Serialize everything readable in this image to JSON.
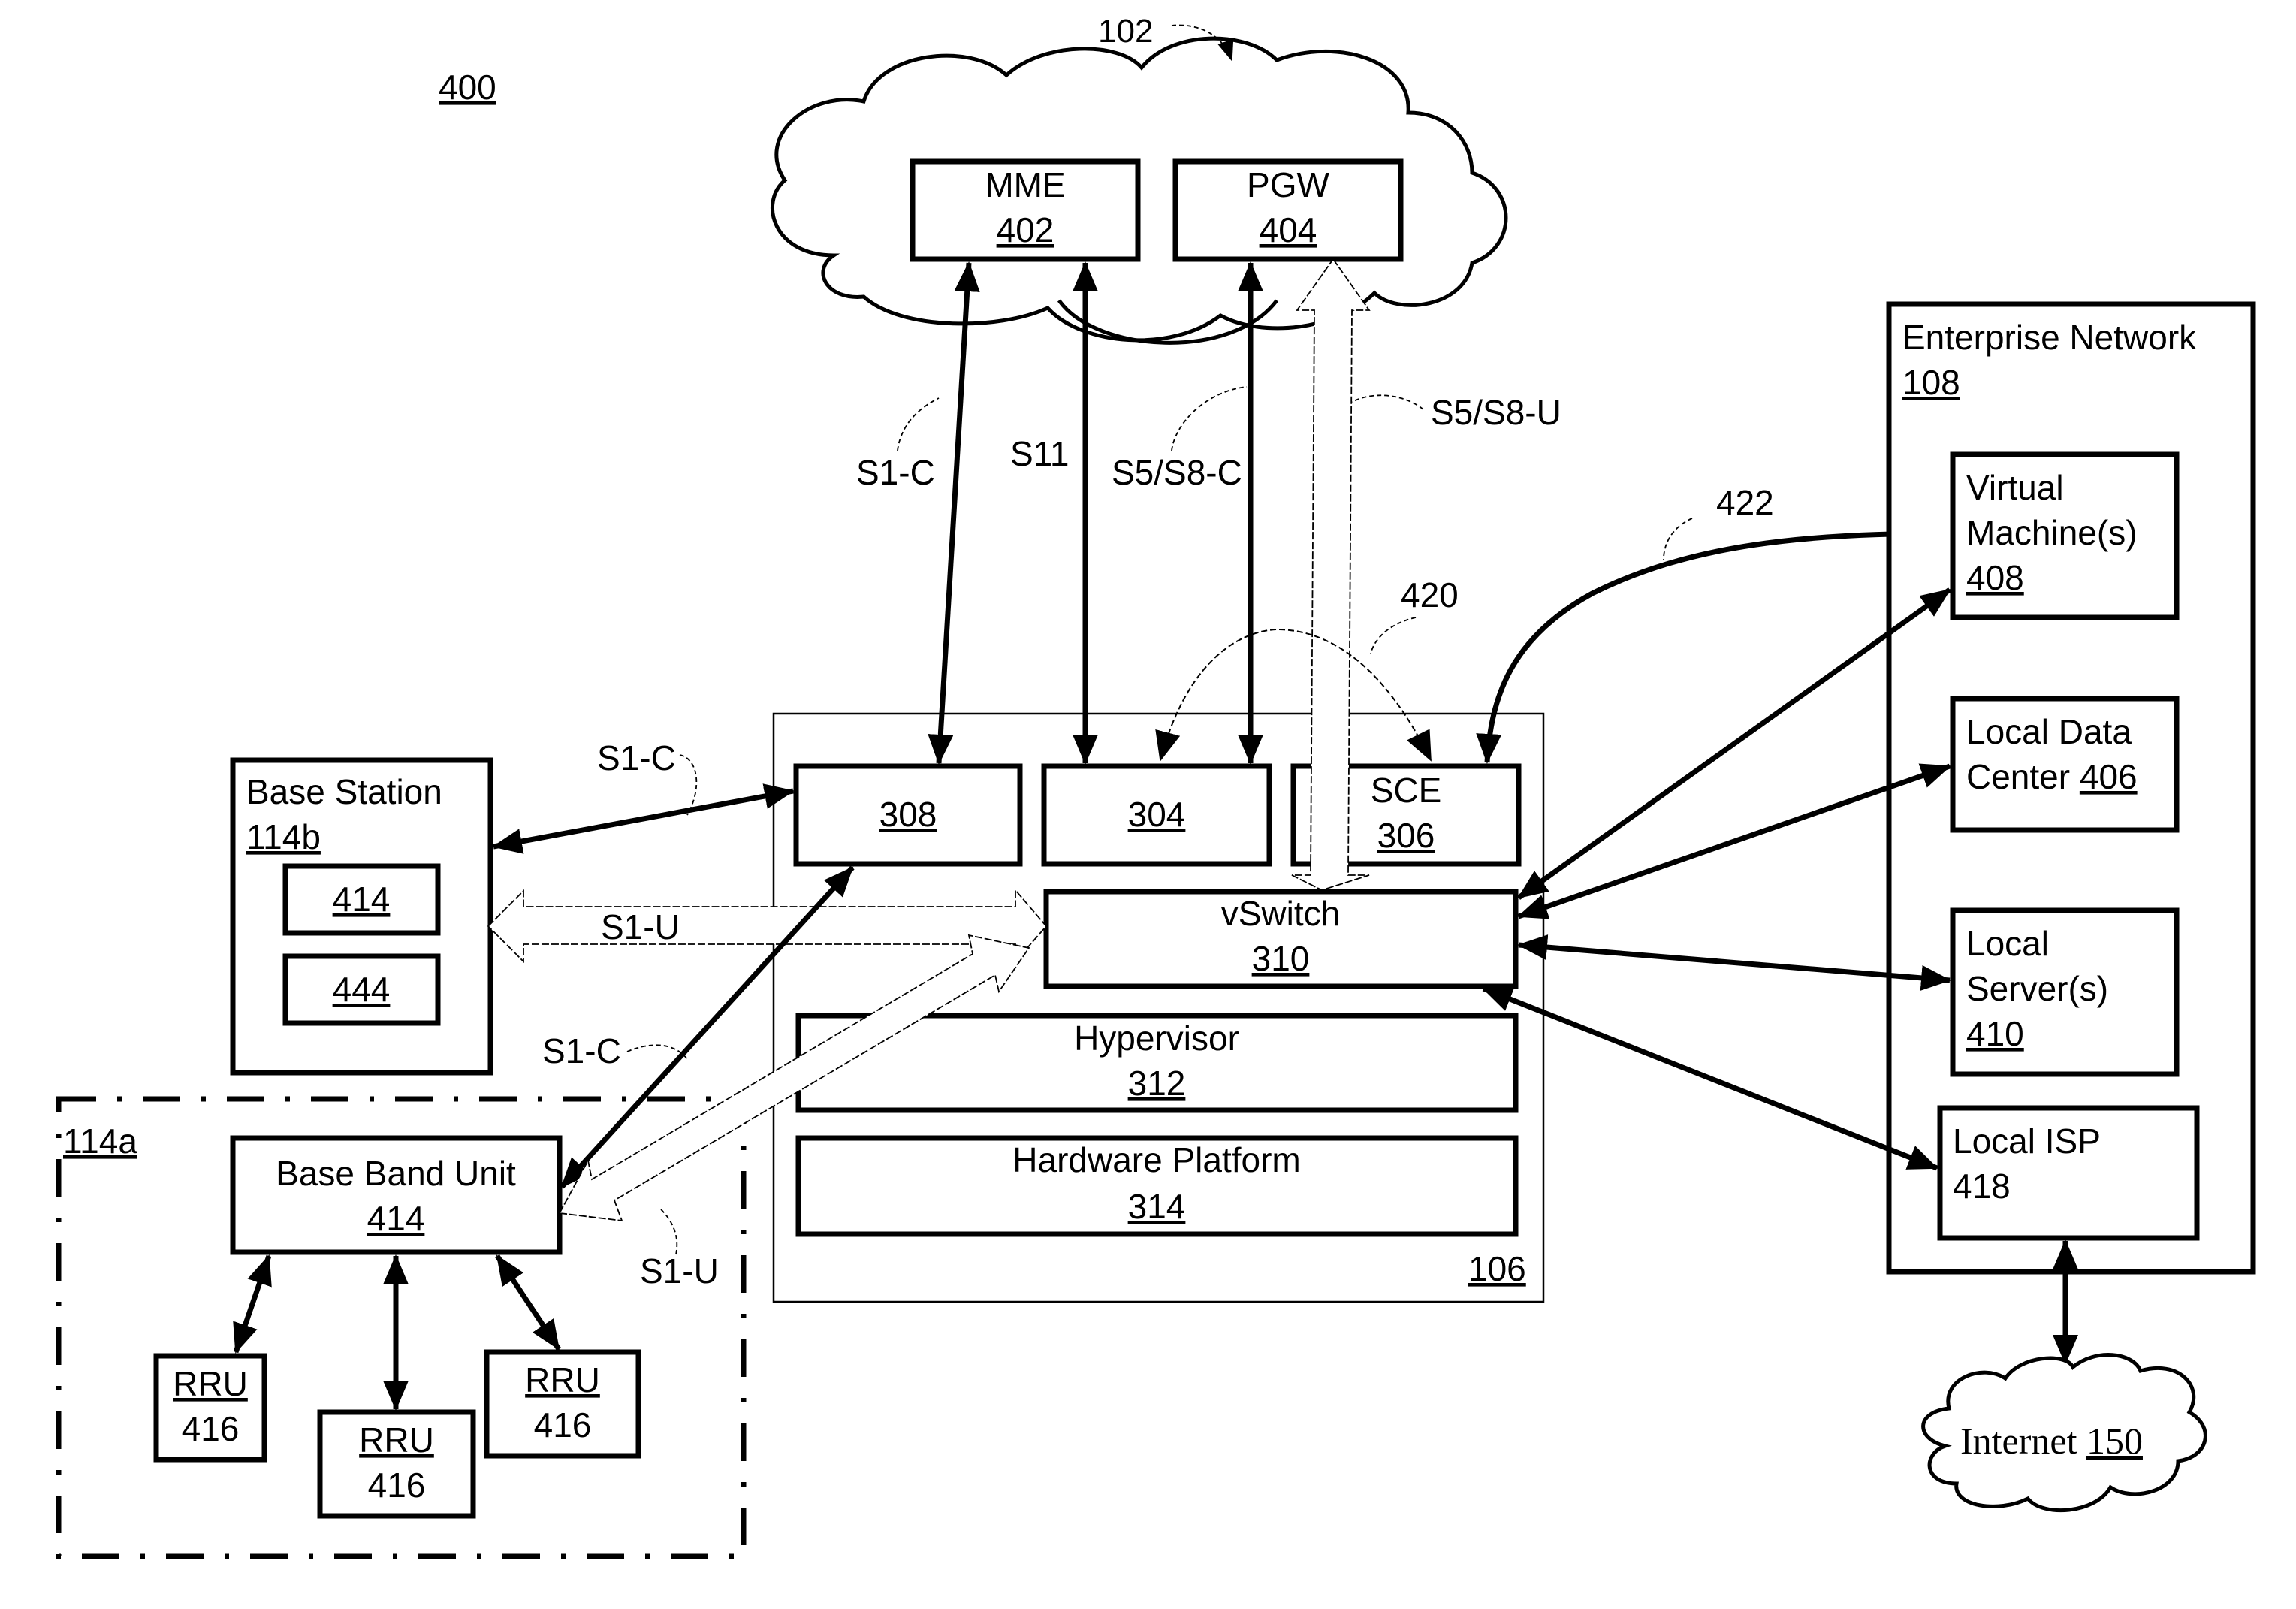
{
  "figure": {
    "ref": "400"
  },
  "core_network": {
    "ref": "102",
    "mme": {
      "label": "MME",
      "ref": "402"
    },
    "pgw": {
      "label": "PGW",
      "ref": "404"
    }
  },
  "interfaces": {
    "s1c_top": "S1-C",
    "s11": "S11",
    "s5s8c": "S5/S8-C",
    "s5s8u": "S5/S8-U",
    "s1c_bs": "S1-C",
    "s1u_bs": "S1-U",
    "s1c_bbu": "S1-C",
    "s1u_bbu": "S1-U"
  },
  "flows": {
    "flow_420": "420",
    "flow_422": "422"
  },
  "edge_node": {
    "ref": "106",
    "box_308": {
      "ref": "308"
    },
    "box_304": {
      "ref": "304"
    },
    "sce": {
      "label": "SCE",
      "ref": "306"
    },
    "vswitch": {
      "label": "vSwitch",
      "ref": "310"
    },
    "hypervisor": {
      "label": "Hypervisor",
      "ref": "312"
    },
    "hardware": {
      "label": "Hardware Platform",
      "ref": "314"
    }
  },
  "base_station": {
    "label": "Base Station",
    "ref": "114b",
    "inner": [
      {
        "ref": "414"
      },
      {
        "ref": "444"
      }
    ]
  },
  "distributed_bs": {
    "ref": "114a",
    "bbu": {
      "label": "Base Band Unit",
      "ref": "414"
    },
    "rrus": [
      {
        "label": "RRU",
        "ref": "416"
      },
      {
        "label": "RRU",
        "ref": "416"
      },
      {
        "label": "RRU",
        "ref": "416"
      }
    ]
  },
  "enterprise": {
    "label": "Enterprise Network",
    "ref": "108",
    "vm": {
      "line1": "Virtual",
      "line2": "Machine(s)",
      "ref": "408"
    },
    "ldc": {
      "line1": "Local Data",
      "line2": "Center",
      "ref": "406"
    },
    "ls": {
      "line1": "Local",
      "line2": "Server(s)",
      "ref": "410"
    },
    "isp": {
      "label": "Local ISP",
      "ref": "418"
    }
  },
  "internet": {
    "label": "Internet",
    "ref": "150"
  }
}
